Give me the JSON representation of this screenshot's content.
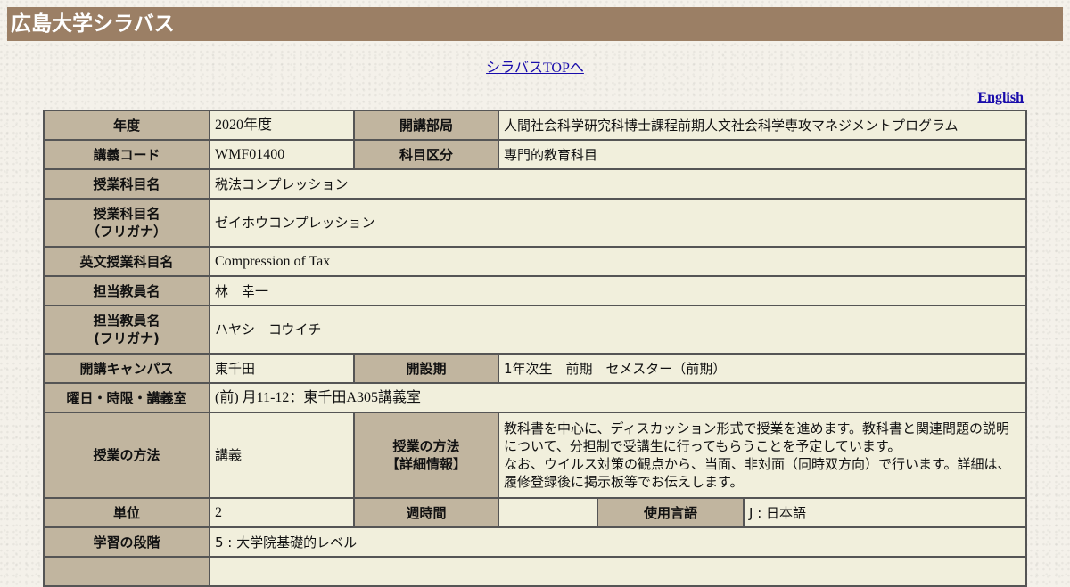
{
  "header": {
    "title": "広島大学シラバス"
  },
  "nav": {
    "top_link": "シラバスTOPへ",
    "english_link": "English"
  },
  "rows": {
    "year_label": "年度",
    "year_value": "2020年度",
    "dept_label": "開講部局",
    "dept_value": "人間社会科学研究科博士課程前期人文社会科学専攻マネジメントプログラム",
    "code_label": "講義コード",
    "code_value": "WMF01400",
    "category_label": "科目区分",
    "category_value": "専門的教育科目",
    "subject_label": "授業科目名",
    "subject_value": "税法コンプレッション",
    "subject_kana_label": "授業科目名\n（フリガナ）",
    "subject_kana_value": "ゼイホウコンプレッション",
    "subject_en_label": "英文授業科目名",
    "subject_en_value": "Compression of Tax",
    "teacher_label": "担当教員名",
    "teacher_value": "林　幸一",
    "teacher_kana_label": "担当教員名\n(フリガナ)",
    "teacher_kana_value": "ハヤシ　コウイチ",
    "campus_label": "開講キャンパス",
    "campus_value": "東千田",
    "term_label": "開設期",
    "term_value": "1年次生　前期　セメスター（前期）",
    "schedule_label": "曜日・時限・講義室",
    "schedule_value": "(前) 月11-12：東千田A305講義室",
    "method_label": "授業の方法",
    "method_value": "講義",
    "method_detail_label": "授業の方法\n【詳細情報】",
    "method_detail_value": "教科書を中心に、ディスカッション形式で授業を進めます。教科書と関連問題の説明について、分担制で受講生に行ってもらうことを予定しています。\nなお、ウイルス対策の観点から、当面、非対面（同時双方向）で行います。詳細は、履修登録後に掲示板等でお伝えします。",
    "credits_label": "単位",
    "credits_value": "2",
    "weekly_label": "週時間",
    "weekly_value": "",
    "language_label": "使用言語",
    "language_value": "J : 日本語",
    "level_label": "学習の段階",
    "level_value": "5 : 大学院基礎的レベル"
  }
}
